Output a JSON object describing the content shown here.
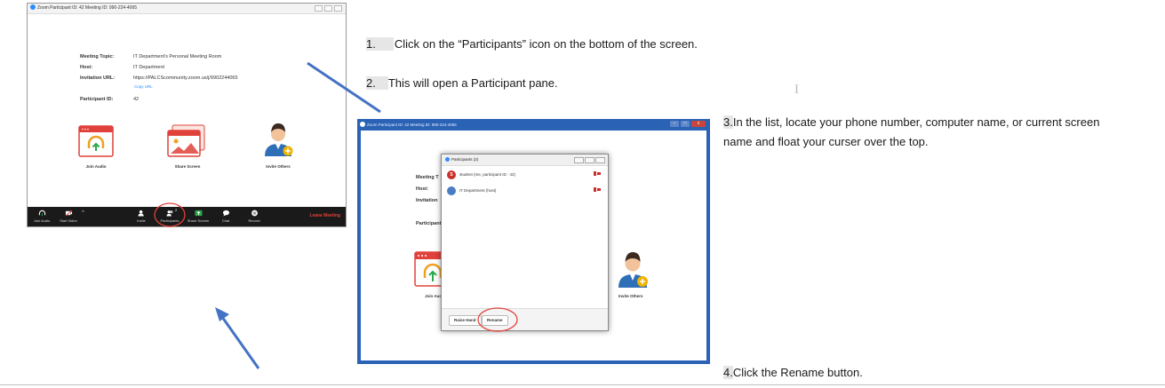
{
  "screenshot1": {
    "title": "Zoom Participant ID: 42   Meeting ID: 990-224-4065",
    "fields": [
      {
        "label": "Meeting Topic:",
        "value": "IT Department's Personal Meeting Room"
      },
      {
        "label": "Host:",
        "value": "IT Department"
      },
      {
        "label": "Invitation URL:",
        "value": "https://PALCScommunity.zoom.us/j/9902244065"
      },
      {
        "label": "Participant ID:",
        "value": "42"
      }
    ],
    "copy_url": "Copy URL",
    "tiles": [
      "Join Audio",
      "Share Screen",
      "Invite Others"
    ],
    "toolbar": [
      "Join Audio",
      "Start Video",
      "Invite",
      "Participants",
      "Share Screen",
      "Chat",
      "Record"
    ],
    "participant_count": "2",
    "leave": "Leave Meeting"
  },
  "screenshot2": {
    "title": "Zoom Participant ID: 42   Meeting ID: 990-224-4065",
    "bg_labels": [
      "Meeting T",
      "Host:",
      "Invitation",
      "Participant"
    ],
    "join_audio": "Join Audio",
    "invite_others": "Invite Others",
    "pane": {
      "title": "Participants (2)",
      "rows": [
        {
          "initial": "S",
          "name": "student  (me, participant ID : 42)",
          "color": "#c9302c"
        },
        {
          "initial": "",
          "name": "IT Department (host)",
          "color": "#4a7cc4"
        }
      ],
      "raise_hand": "Raise Hand",
      "rename": "Rename"
    }
  },
  "steps": [
    {
      "num": "1.",
      "text": "Click on the “Participants” icon on the bottom of the screen."
    },
    {
      "num": "2.",
      "text": "This will open a Participant pane."
    },
    {
      "num": "3.",
      "text": "In the list, locate your phone number, computer name, or current screen",
      "text2": "name and float your curser over the top."
    },
    {
      "num": "4.",
      "text": "Click the Rename button."
    }
  ],
  "colors": {
    "arrow": "#4472c4",
    "highlight_circle": "#e0413a",
    "zoom_blue": "#2d8cff",
    "window_frame": "#2a62b6"
  }
}
